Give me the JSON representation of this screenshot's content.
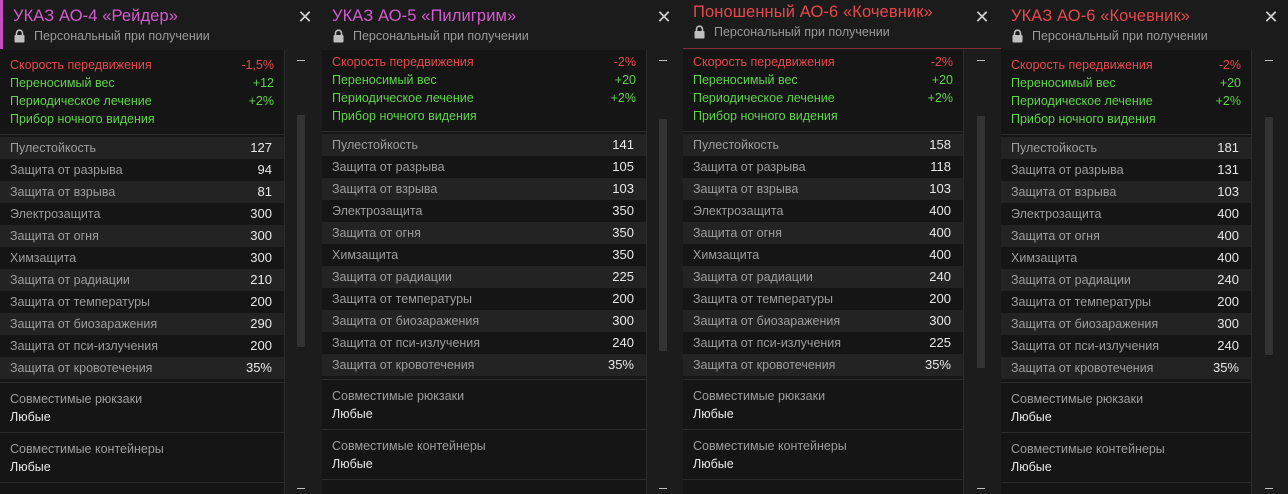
{
  "common": {
    "lock_text": "Персональный при получении",
    "close_glyph": "✕",
    "backpacks_label": "Совместимые рюкзаки",
    "backpacks_value": "Любые",
    "containers_label": "Совместимые контейнеры",
    "containers_value": "Любые",
    "scroll_cap_glyph": "−"
  },
  "colors": {
    "title_pink": "#d45bd0",
    "title_red": "#e5484d",
    "bonus_red": "#e5484d",
    "bonus_green": "#5fd34c",
    "accent_bar": "#c24fbf"
  },
  "cards": [
    {
      "title": "УКАЗ АО-4 «Рейдер»",
      "title_color": "pink",
      "bonuses": [
        {
          "name": "Скорость передвижения",
          "value": "-1,5%",
          "color": "red"
        },
        {
          "name": "Переносимый вес",
          "value": "+12",
          "color": "green"
        },
        {
          "name": "Периодическое лечение",
          "value": "+2%",
          "color": "green"
        },
        {
          "name": "Прибор ночного видения",
          "value": "",
          "color": "green"
        }
      ],
      "stats": [
        {
          "name": "Пулестойкость",
          "value": "127"
        },
        {
          "name": "Защита от разрыва",
          "value": "94"
        },
        {
          "name": "Защита от взрыва",
          "value": "81"
        },
        {
          "name": "Электрозащита",
          "value": "300"
        },
        {
          "name": "Защита от огня",
          "value": "300"
        },
        {
          "name": "Химзащита",
          "value": "300"
        },
        {
          "name": "Защита от радиации",
          "value": "210"
        },
        {
          "name": "Защита от температуры",
          "value": "200"
        },
        {
          "name": "Защита от биозаражения",
          "value": "290"
        },
        {
          "name": "Защита от пси-излучения",
          "value": "200"
        },
        {
          "name": "Защита от кровотечения",
          "value": "35%"
        }
      ]
    },
    {
      "title": "УКАЗ АО-5 «Пилигрим»",
      "title_color": "pink",
      "bonuses": [
        {
          "name": "Скорость передвижения",
          "value": "-2%",
          "color": "red"
        },
        {
          "name": "Переносимый вес",
          "value": "+20",
          "color": "green"
        },
        {
          "name": "Периодическое лечение",
          "value": "+2%",
          "color": "green"
        },
        {
          "name": "Прибор ночного видения",
          "value": "",
          "color": "green"
        }
      ],
      "stats": [
        {
          "name": "Пулестойкость",
          "value": "141"
        },
        {
          "name": "Защита от разрыва",
          "value": "105"
        },
        {
          "name": "Защита от взрыва",
          "value": "103"
        },
        {
          "name": "Электрозащита",
          "value": "350"
        },
        {
          "name": "Защита от огня",
          "value": "350"
        },
        {
          "name": "Химзащита",
          "value": "350"
        },
        {
          "name": "Защита от радиации",
          "value": "225"
        },
        {
          "name": "Защита от температуры",
          "value": "200"
        },
        {
          "name": "Защита от биозаражения",
          "value": "300"
        },
        {
          "name": "Защита от пси-излучения",
          "value": "240"
        },
        {
          "name": "Защита от кровотечения",
          "value": "35%"
        }
      ]
    },
    {
      "title": "Поношенный АО-6 «Кочевник»",
      "title_color": "red",
      "bonuses": [
        {
          "name": "Скорость передвижения",
          "value": "-2%",
          "color": "red"
        },
        {
          "name": "Переносимый вес",
          "value": "+20",
          "color": "green"
        },
        {
          "name": "Периодическое лечение",
          "value": "+2%",
          "color": "green"
        },
        {
          "name": "Прибор ночного видения",
          "value": "",
          "color": "green"
        }
      ],
      "stats": [
        {
          "name": "Пулестойкость",
          "value": "158"
        },
        {
          "name": "Защита от разрыва",
          "value": "118"
        },
        {
          "name": "Защита от взрыва",
          "value": "103"
        },
        {
          "name": "Электрозащита",
          "value": "400"
        },
        {
          "name": "Защита от огня",
          "value": "400"
        },
        {
          "name": "Химзащита",
          "value": "400"
        },
        {
          "name": "Защита от радиации",
          "value": "240"
        },
        {
          "name": "Защита от температуры",
          "value": "200"
        },
        {
          "name": "Защита от биозаражения",
          "value": "300"
        },
        {
          "name": "Защита от пси-излучения",
          "value": "225"
        },
        {
          "name": "Защита от кровотечения",
          "value": "35%"
        }
      ]
    },
    {
      "title": "УКАЗ АО-6 «Кочевник»",
      "title_color": "red",
      "bonuses": [
        {
          "name": "Скорость передвижения",
          "value": "-2%",
          "color": "red"
        },
        {
          "name": "Переносимый вес",
          "value": "+20",
          "color": "green"
        },
        {
          "name": "Периодическое лечение",
          "value": "+2%",
          "color": "green"
        },
        {
          "name": "Прибор ночного видения",
          "value": "",
          "color": "green"
        }
      ],
      "stats": [
        {
          "name": "Пулестойкость",
          "value": "181"
        },
        {
          "name": "Защита от разрыва",
          "value": "131"
        },
        {
          "name": "Защита от взрыва",
          "value": "103"
        },
        {
          "name": "Электрозащита",
          "value": "400"
        },
        {
          "name": "Защита от огня",
          "value": "400"
        },
        {
          "name": "Химзащита",
          "value": "400"
        },
        {
          "name": "Защита от радиации",
          "value": "240"
        },
        {
          "name": "Защита от температуры",
          "value": "200"
        },
        {
          "name": "Защита от биозаражения",
          "value": "300"
        },
        {
          "name": "Защита от пси-излучения",
          "value": "240"
        },
        {
          "name": "Защита от кровотечения",
          "value": "35%"
        }
      ]
    }
  ]
}
